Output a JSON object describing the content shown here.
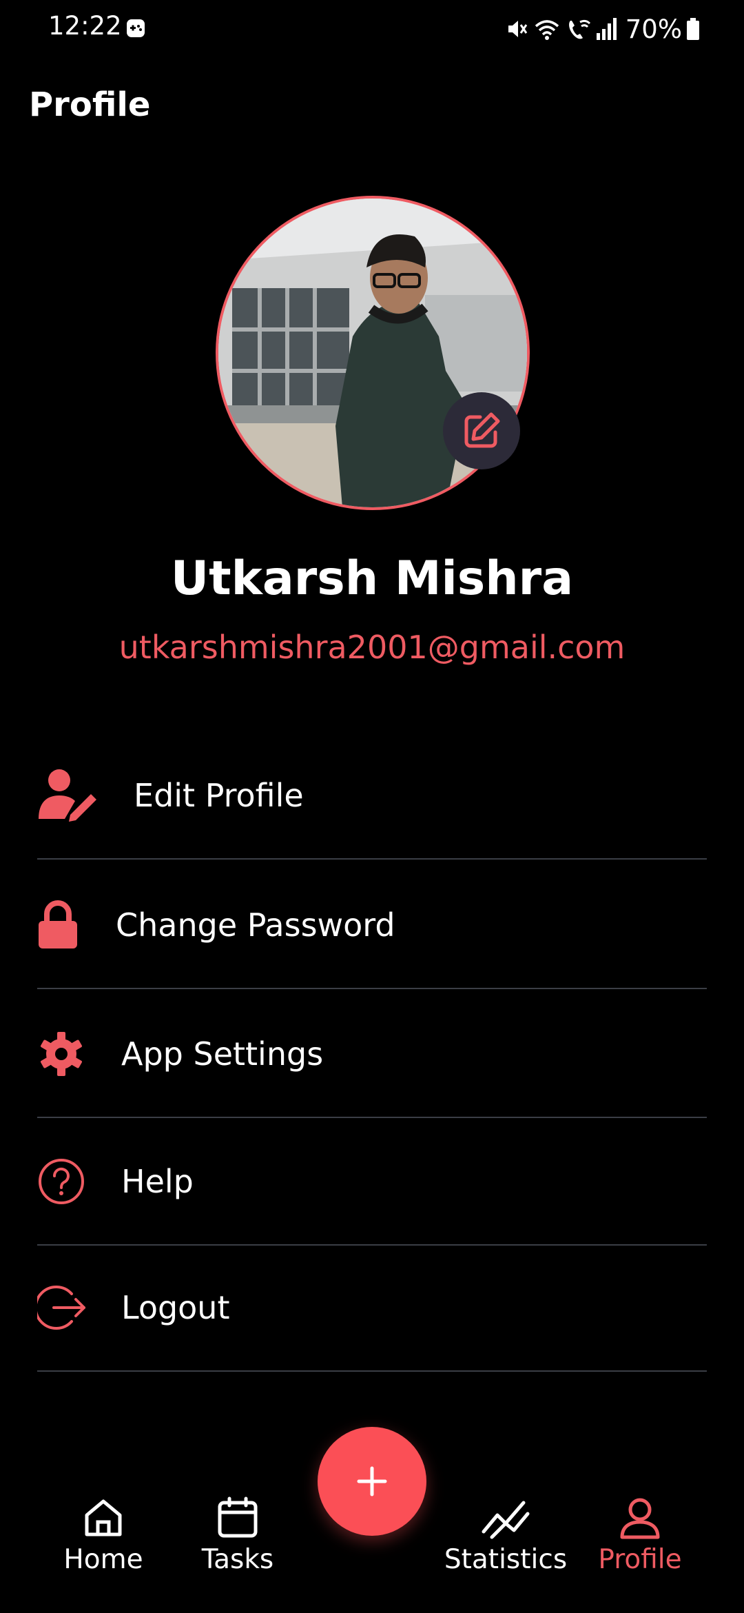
{
  "status_bar": {
    "time": "12:22",
    "battery": "70%",
    "icons": [
      "game-icon",
      "mute-icon",
      "wifi-icon",
      "wifi-call-icon",
      "signal-icon",
      "battery-icon"
    ]
  },
  "header": {
    "title": "Profile"
  },
  "profile": {
    "name": "Utkarsh Mishra",
    "email": "utkarshmishra2001@gmail.com"
  },
  "menu": [
    {
      "label": "Edit Profile",
      "icon": "user-edit-icon"
    },
    {
      "label": "Change Password",
      "icon": "lock-icon"
    },
    {
      "label": "App Settings",
      "icon": "gear-icon"
    },
    {
      "label": "Help",
      "icon": "help-circle-icon"
    },
    {
      "label": "Logout",
      "icon": "logout-icon"
    }
  ],
  "bottom_nav": {
    "items": [
      {
        "label": "Home",
        "icon": "home-icon"
      },
      {
        "label": "Tasks",
        "icon": "calendar-icon"
      },
      {
        "label": "Statistics",
        "icon": "chart-icon"
      },
      {
        "label": "Profile",
        "icon": "user-icon",
        "active": true
      }
    ],
    "fab_icon": "plus-icon"
  },
  "colors": {
    "accent": "#ef5b62",
    "background": "#000000",
    "divider": "#3b3e46",
    "fab": "#fb4f56"
  }
}
